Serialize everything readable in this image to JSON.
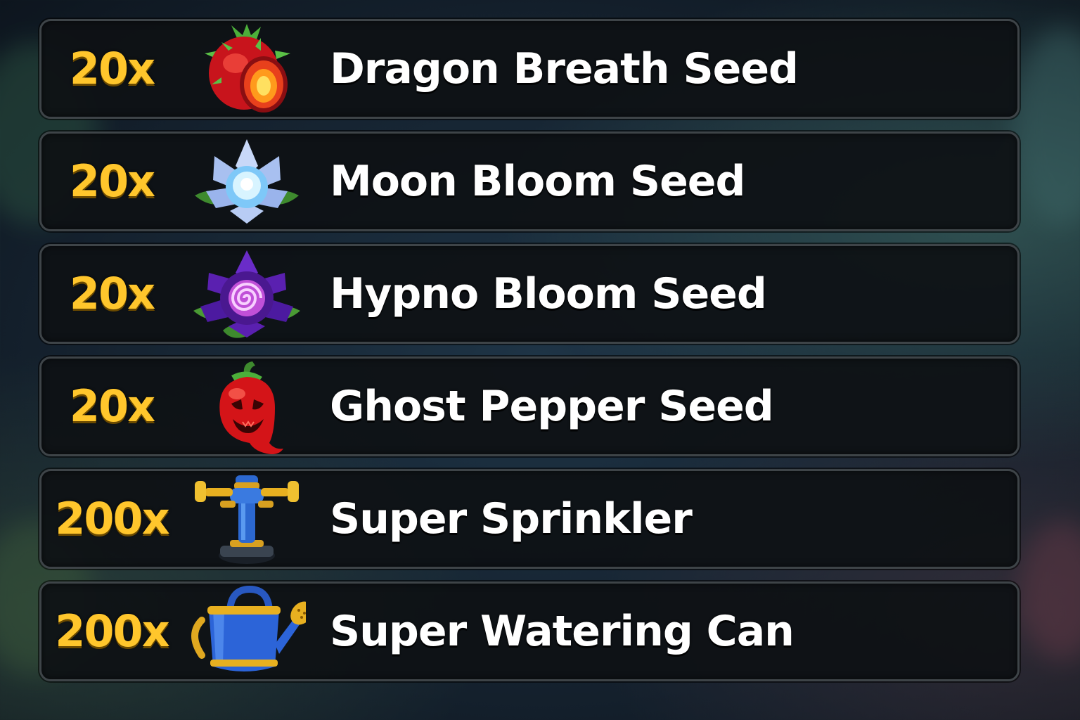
{
  "rewards": [
    {
      "quantity": "20x",
      "name": "Dragon Breath Seed",
      "icon": "dragon-fruit-icon"
    },
    {
      "quantity": "20x",
      "name": "Moon Bloom Seed",
      "icon": "moon-bloom-icon"
    },
    {
      "quantity": "20x",
      "name": "Hypno Bloom Seed",
      "icon": "hypno-bloom-icon"
    },
    {
      "quantity": "20x",
      "name": "Ghost Pepper Seed",
      "icon": "ghost-pepper-icon"
    },
    {
      "quantity": "200x",
      "name": "Super Sprinkler",
      "icon": "sprinkler-icon"
    },
    {
      "quantity": "200x",
      "name": "Super Watering Can",
      "icon": "watering-can-icon"
    }
  ],
  "colors": {
    "quantity": "#ffc62c",
    "name": "#ffffff",
    "row_background": "#0e1114",
    "row_border": "#3e4448"
  }
}
